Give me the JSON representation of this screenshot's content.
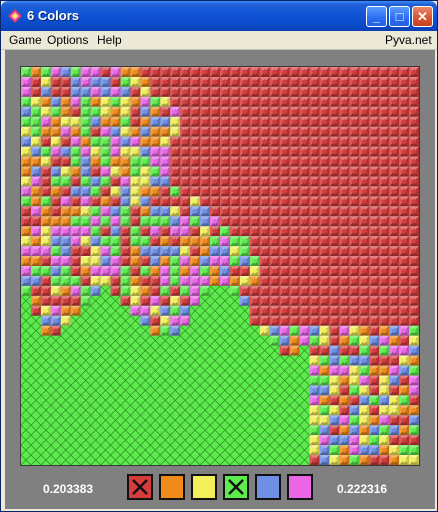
{
  "window": {
    "title": "6 Colors",
    "buttons": {
      "minimize": "_",
      "maximize": "□",
      "close": "✕"
    }
  },
  "menu": {
    "items": [
      "Game",
      "Options",
      "Help"
    ],
    "link": "Pyva.net"
  },
  "game": {
    "grid_size": 40,
    "colors": {
      "red": "#d63c3c",
      "orange": "#f08a1a",
      "yellow": "#f2ef5a",
      "green": "#5cec4c",
      "blue": "#6f8fe6",
      "magenta": "#ea66e6"
    },
    "palette_order": [
      "red",
      "orange",
      "yellow",
      "green",
      "blue",
      "magenta"
    ],
    "disabled_colors": [
      "red",
      "green"
    ],
    "player_left": {
      "color": "green",
      "score": "0.203383"
    },
    "player_right": {
      "color": "red",
      "score": "0.222316"
    }
  }
}
